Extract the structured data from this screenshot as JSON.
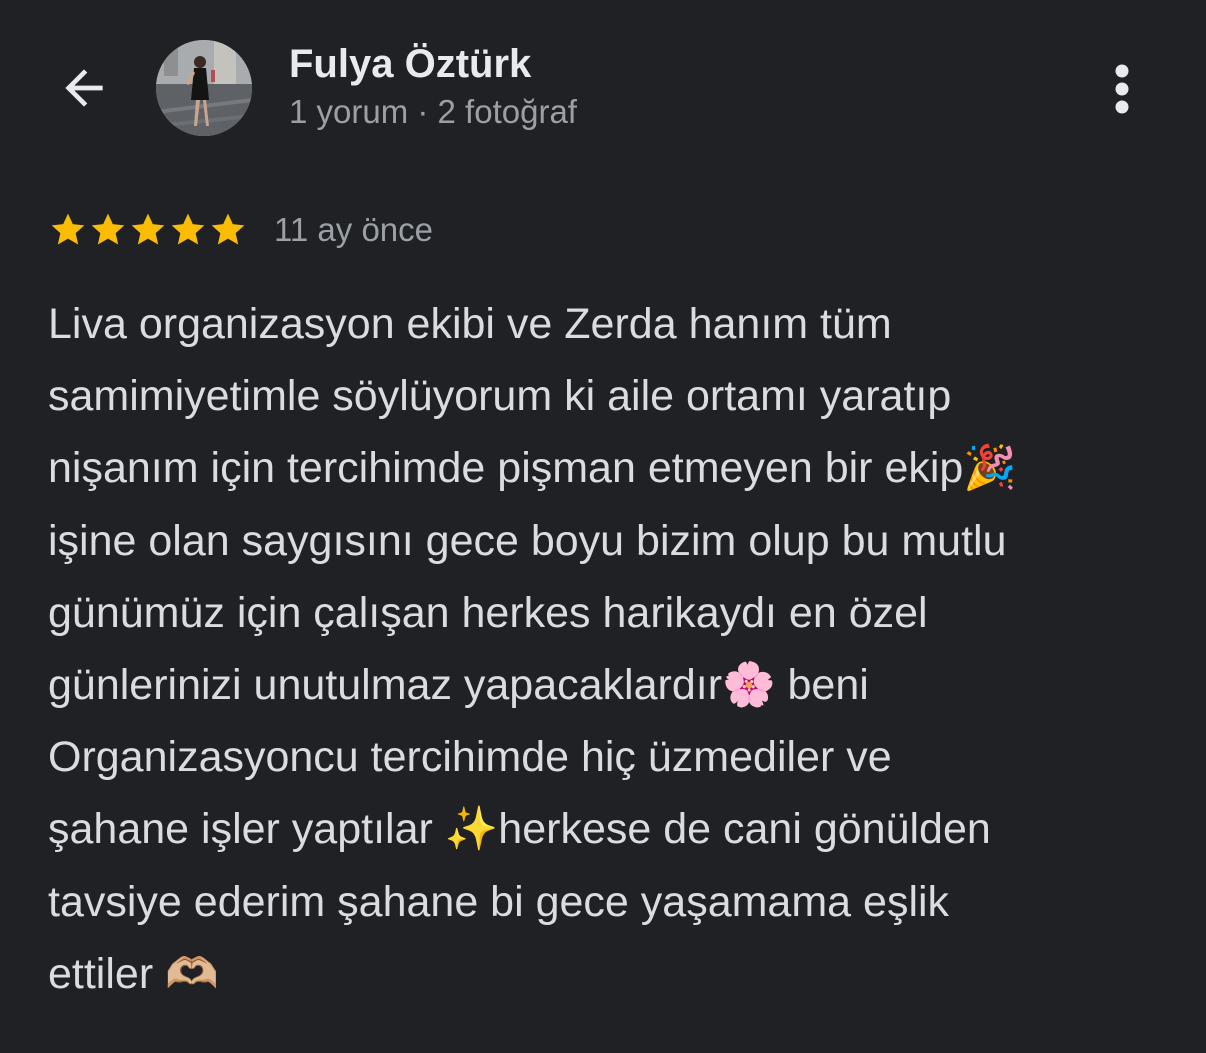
{
  "header": {
    "back_icon": "arrow-back-icon",
    "user_name": "Fulya Öztürk",
    "user_meta": "1 yorum · 2 fotoğraf",
    "more_icon": "more-vertical-icon"
  },
  "review": {
    "rating": 5,
    "max_rating": 5,
    "star_color": "#fbbc04",
    "time": "11 ay önce",
    "text": "Liva organizasyon ekibi ve Zerda hanım tüm\nsamimiyetimle söylüyorum ki aile ortamı yaratıp\nnişanım için tercihimde pişman etmeyen bir ekip🎉\nişine olan saygısını gece boyu bizim olup bu mutlu\ngünümüz için çalışan herkes harikaydı en özel\ngünlerinizi unutulmaz yapacaklardır🌸 beni\nOrganizasyoncu tercihimde hiç üzmediler ve\nşahane işler yaptılar ✨herkese de cani gönülden\ntavsiye ederim şahane bi gece yaşamama eşlik\nettiler 🫶🏼"
  },
  "colors": {
    "background": "#202124",
    "primary_text": "#e8eaed",
    "secondary_text": "#9aa0a6",
    "body_text": "#dadce0"
  }
}
